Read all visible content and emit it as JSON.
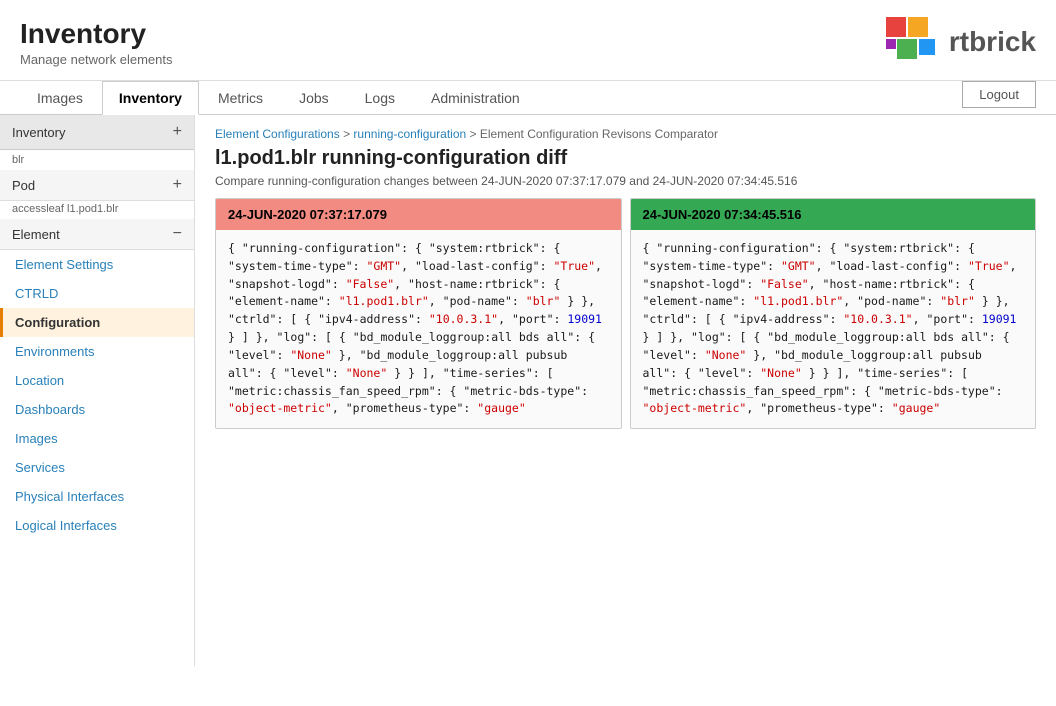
{
  "header": {
    "title": "Inventory",
    "subtitle": "Manage network elements",
    "logout_label": "Logout"
  },
  "nav": {
    "tabs": [
      {
        "id": "images",
        "label": "Images",
        "active": false
      },
      {
        "id": "inventory",
        "label": "Inventory",
        "active": true
      },
      {
        "id": "metrics",
        "label": "Metrics",
        "active": false
      },
      {
        "id": "jobs",
        "label": "Jobs",
        "active": false
      },
      {
        "id": "logs",
        "label": "Logs",
        "active": false
      },
      {
        "id": "administration",
        "label": "Administration",
        "active": false
      }
    ]
  },
  "sidebar": {
    "inventory_label": "Inventory",
    "inventory_plus": "+",
    "blr_label": "blr",
    "pod_label": "Pod",
    "pod_plus": "+",
    "element_path": "accessleaf l1.pod1.blr",
    "element_label": "Element",
    "element_minus": "−",
    "items": [
      {
        "id": "element-settings",
        "label": "Element Settings",
        "type": "link",
        "active": false
      },
      {
        "id": "ctrld",
        "label": "CTRLD",
        "type": "link",
        "active": false
      },
      {
        "id": "configuration",
        "label": "Configuration",
        "type": "item",
        "active": true
      },
      {
        "id": "environments",
        "label": "Environments",
        "type": "link",
        "active": false
      },
      {
        "id": "location",
        "label": "Location",
        "type": "link",
        "active": false
      },
      {
        "id": "dashboards",
        "label": "Dashboards",
        "type": "link",
        "active": false
      },
      {
        "id": "images",
        "label": "Images",
        "type": "link",
        "active": false
      },
      {
        "id": "services",
        "label": "Services",
        "type": "link",
        "active": false
      },
      {
        "id": "physical-interfaces",
        "label": "Physical Interfaces",
        "type": "link",
        "active": false
      },
      {
        "id": "logical-interfaces",
        "label": "Logical Interfaces",
        "type": "link",
        "active": false
      }
    ]
  },
  "content": {
    "breadcrumb": {
      "part1": "Element Configurations",
      "sep1": " > ",
      "part2": "running-configuration",
      "sep2": " > ",
      "part3": "Element Configuration Revisons Comparator"
    },
    "page_title": "l1.pod1.blr running-configuration diff",
    "compare_desc": "Compare running-configuration changes between 24-JUN-2020 07:37:17.079 and 24-JUN-2020 07:34:45.516",
    "left_panel": {
      "header": "24-JUN-2020 07:37:17.079"
    },
    "right_panel": {
      "header": "24-JUN-2020 07:34:45.516"
    }
  }
}
